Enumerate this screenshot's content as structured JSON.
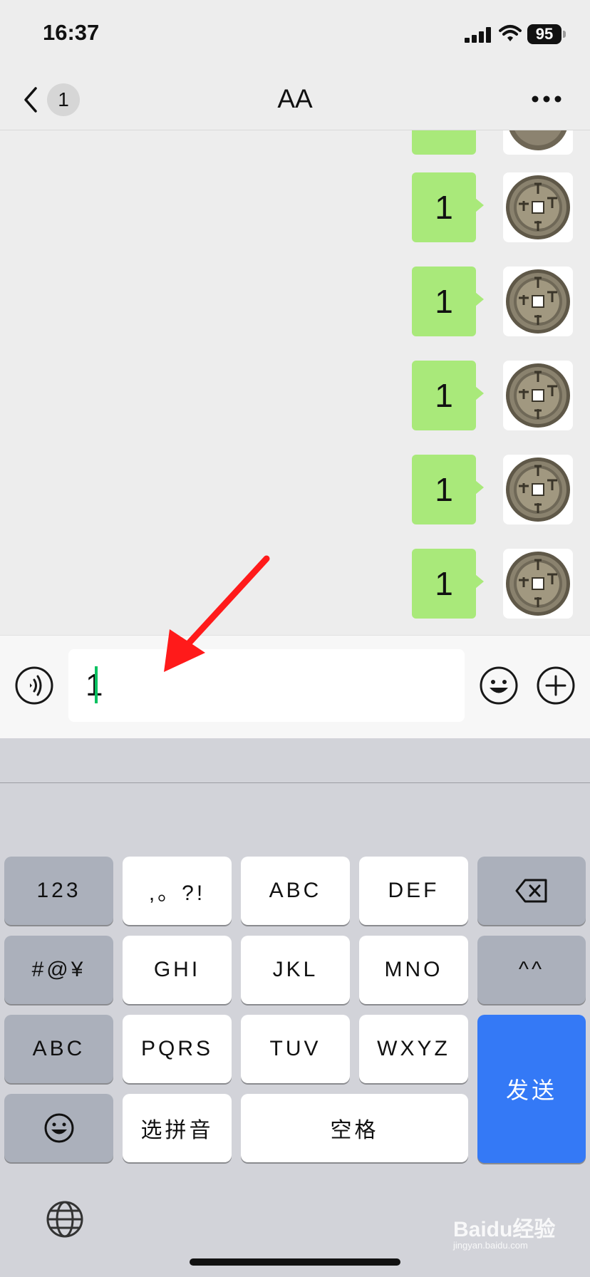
{
  "status_bar": {
    "time": "16:37",
    "battery": "95"
  },
  "nav": {
    "back_badge": "1",
    "title": "AA",
    "more_icon": "more-icon"
  },
  "messages": [
    {
      "text": "1",
      "sender": "self"
    },
    {
      "text": "1",
      "sender": "self"
    },
    {
      "text": "1",
      "sender": "self"
    },
    {
      "text": "1",
      "sender": "self"
    },
    {
      "text": "1",
      "sender": "self"
    }
  ],
  "input": {
    "value": "1"
  },
  "keyboard": {
    "rows": [
      [
        "123",
        ",。?!",
        "ABC",
        "DEF",
        "delete-icon"
      ],
      [
        "#@¥",
        "GHI",
        "JKL",
        "MNO",
        "^^"
      ],
      [
        "ABC",
        "PQRS",
        "TUV",
        "WXYZ",
        "发送"
      ],
      [
        "emoji-icon",
        "选拼音",
        "空格"
      ]
    ],
    "key_123": "123",
    "key_punct": ",。?!",
    "key_abc": "ABC",
    "key_def": "DEF",
    "key_symbols": "#@¥",
    "key_ghi": "GHI",
    "key_jkl": "JKL",
    "key_mno": "MNO",
    "key_face": "^^",
    "key_abc_mode": "ABC",
    "key_pqrs": "PQRS",
    "key_tuv": "TUV",
    "key_wxyz": "WXYZ",
    "key_send": "发送",
    "key_pinyin": "选拼音",
    "key_space": "空格"
  },
  "watermark": {
    "brand": "Baidu经验",
    "url": "jingyan.baidu.com"
  },
  "colors": {
    "bubble": "#a9e97a",
    "send_key": "#3479f6",
    "caret": "#07c160",
    "arrow": "#ff1a1a"
  }
}
